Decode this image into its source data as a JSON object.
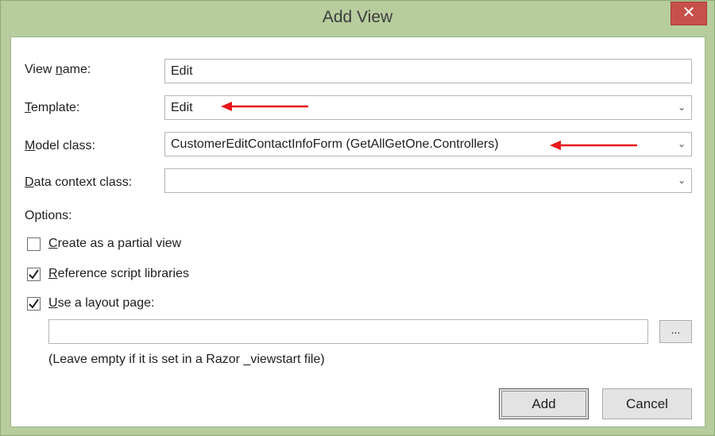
{
  "window": {
    "title": "Add View",
    "close_glyph": "✕"
  },
  "form": {
    "view_name": {
      "label_pre": "View ",
      "label_accel": "n",
      "label_post": "ame:",
      "value": "Edit"
    },
    "template": {
      "label_accel": "T",
      "label_post": "emplate:",
      "value": "Edit"
    },
    "model_class": {
      "label_accel": "M",
      "label_post": "odel class:",
      "value": "CustomerEditContactInfoForm (GetAllGetOne.Controllers)"
    },
    "data_context_class": {
      "label_accel": "D",
      "label_post": "ata context class:",
      "value": ""
    },
    "dropdown_glyph": "⌄"
  },
  "options": {
    "heading": "Options:",
    "partial_view": {
      "accel": "C",
      "rest": "reate as a partial view",
      "checked": false
    },
    "reference_scripts": {
      "accel": "R",
      "rest": "eference script libraries",
      "checked": true
    },
    "use_layout": {
      "accel": "U",
      "rest": "se a layout page:",
      "checked": true
    },
    "layout_path": "",
    "browse_label": "...",
    "hint": "(Leave empty if it is set in a Razor _viewstart file)"
  },
  "buttons": {
    "add": "Add",
    "cancel": "Cancel"
  },
  "annotation": {
    "arrow_color": "#e8161b"
  }
}
